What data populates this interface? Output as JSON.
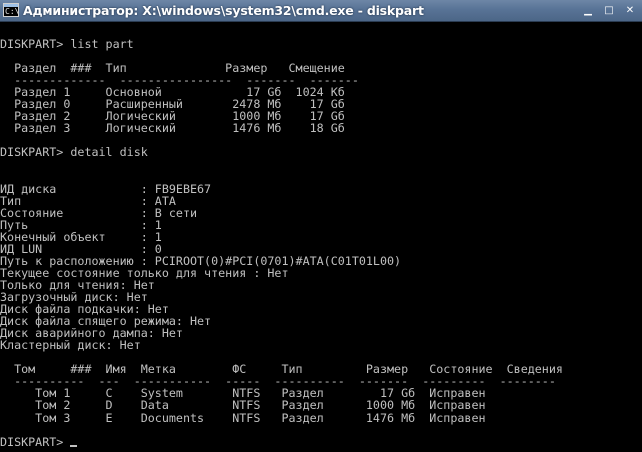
{
  "window": {
    "title": "Администратор: X:\\windows\\system32\\cmd.exe - diskpart",
    "icon": "cmd-icon",
    "icon_glyph": "C:\\"
  },
  "console": {
    "lines": [
      "",
      "DISKPART> list part",
      "",
      "  Раздел  ###  Тип              Размер   Смещение",
      "  -------------  ----------------  -------  -------",
      "  Раздел 1     Основной            17 Gб  1024 Kб",
      "  Раздел 0     Расширенный       2478 Mб    17 Gб",
      "  Раздел 2     Логический        1000 Mб    17 Gб",
      "  Раздел 3     Логический        1476 Mб    18 Gб",
      "",
      "DISKPART> detail disk",
      "",
      "",
      "ИД диска            : FB9EBE67",
      "Тип                 : ATA",
      "Состояние           : В сети",
      "Путь                : 1",
      "Конечный объект     : 1",
      "ИД LUN              : 0",
      "Путь к расположению : PCIROOT(0)#PCI(0701)#ATA(C01T01L00)",
      "Текущее состояние только для чтения : Нет",
      "Только для чтения: Нет",
      "Загрузочный диск: Нет",
      "Диск файла подкачки: Нет",
      "Диск файла спящего режима: Нет",
      "Диск аварийного дампа: Нет",
      "Кластерный диск: Нет",
      "",
      "  Том     ###  Имя  Метка        ФС     Тип         Размер   Состояние  Сведения",
      "  ----------  ---  -----------  -----  ----------  -------  ---------  --------",
      "     Том 1     C    System       NTFS   Раздел        17 Gб  Исправен",
      "     Том 2     D    Data         NTFS   Раздел      1000 Mб  Исправен",
      "     Том 3     E    Documents    NTFS   Раздел      1476 Mб  Исправен",
      "",
      "DISKPART> "
    ]
  },
  "colors": {
    "background": "#000000",
    "text": "#c0c0c0",
    "titlebar": "#587396"
  }
}
